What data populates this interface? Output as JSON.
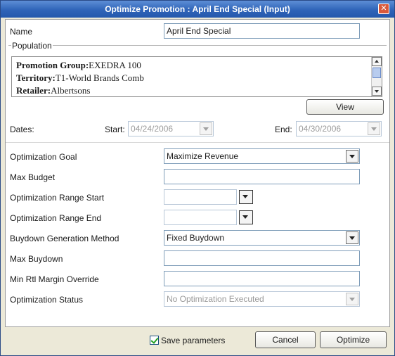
{
  "window": {
    "title": "Optimize Promotion : April End Special (Input)",
    "close_glyph": "✕"
  },
  "name": {
    "label": "Name",
    "value": "April End Special"
  },
  "population": {
    "label": "Population",
    "lines": [
      {
        "key": "Promotion Group:",
        "value": "EXEDRA 100"
      },
      {
        "key": "Territory:",
        "value": "T1-World Brands Comb"
      },
      {
        "key": "Retailer:",
        "value": "Albertsons"
      }
    ],
    "view_button": "View"
  },
  "dates": {
    "label": "Dates:",
    "start_label": "Start:",
    "start_value": "04/24/2006",
    "end_label": "End:",
    "end_value": "04/30/2006"
  },
  "form": {
    "optimization_goal": {
      "label": "Optimization Goal",
      "value": "Maximize Revenue"
    },
    "max_budget": {
      "label": "Max Budget",
      "value": ""
    },
    "range_start": {
      "label": "Optimization Range Start",
      "value": ""
    },
    "range_end": {
      "label": "Optimization Range End",
      "value": ""
    },
    "buydown_method": {
      "label": "Buydown Generation Method",
      "value": "Fixed Buydown"
    },
    "max_buydown": {
      "label": "Max Buydown",
      "value": ""
    },
    "min_margin": {
      "label": "Min Rtl Margin Override",
      "value": ""
    },
    "status": {
      "label": "Optimization Status",
      "value": "No Optimization Executed"
    }
  },
  "footer": {
    "save_parameters": "Save parameters",
    "save_checked": true,
    "cancel": "Cancel",
    "optimize": "Optimize"
  }
}
